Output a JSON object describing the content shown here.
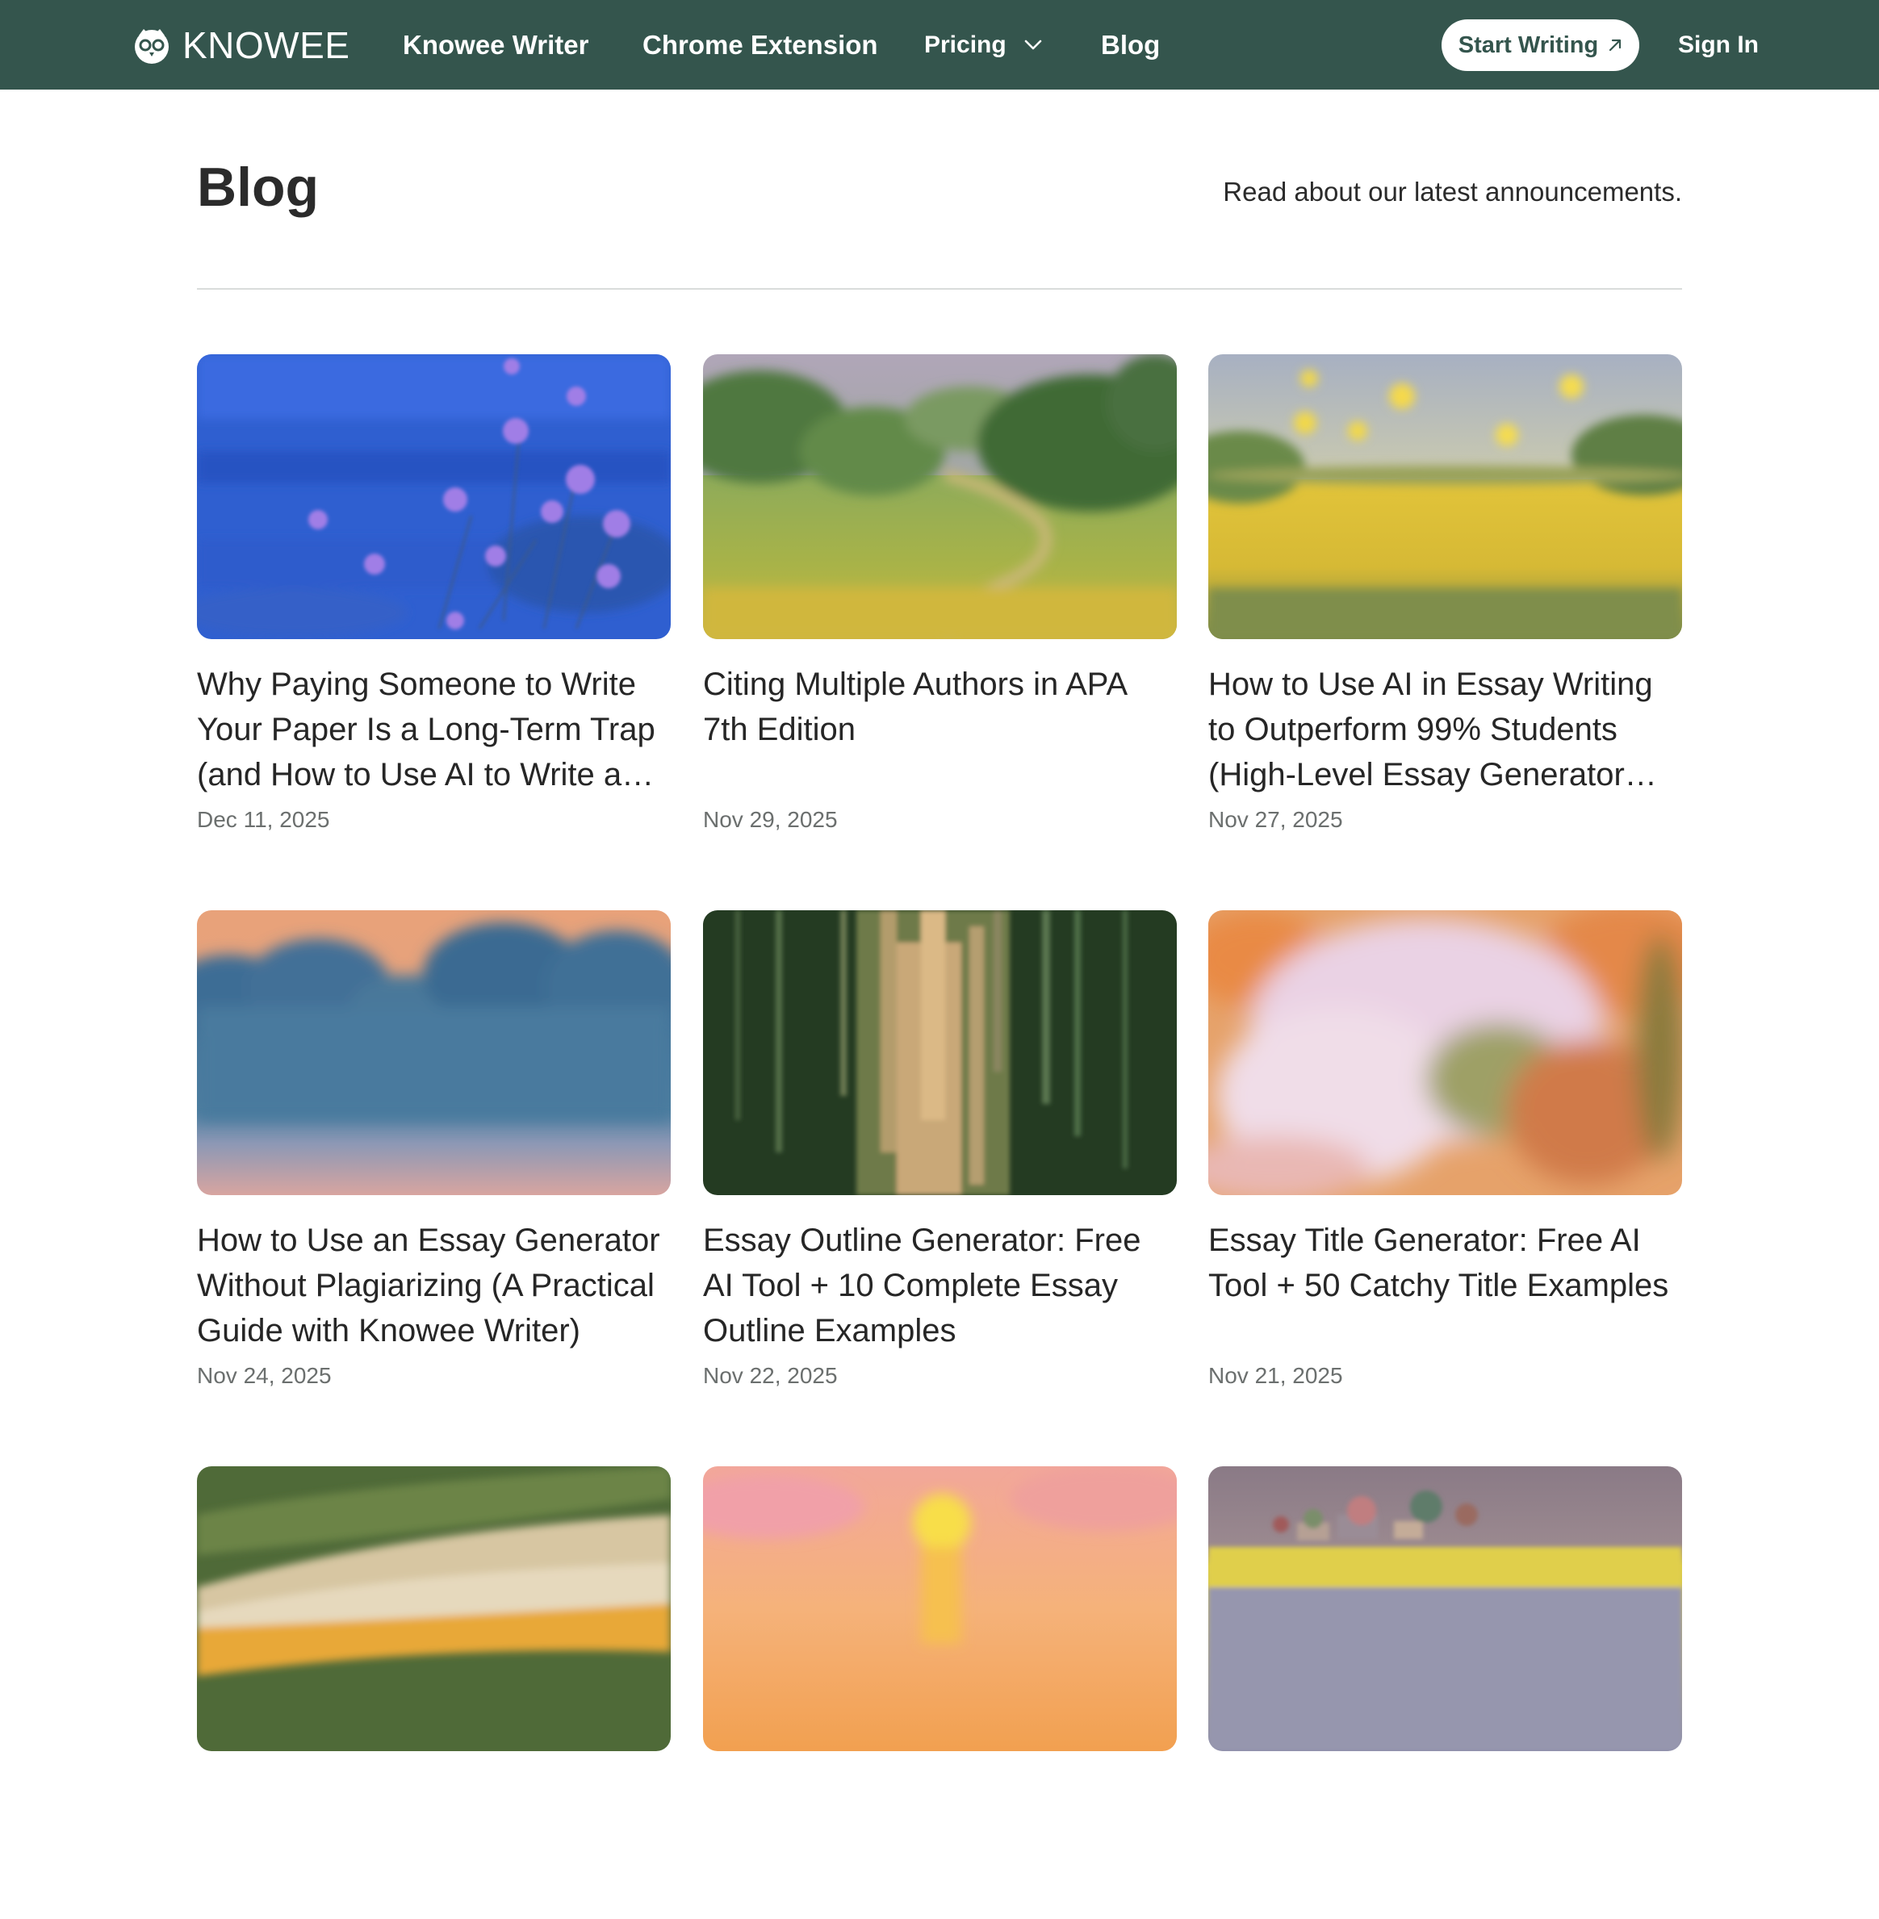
{
  "header": {
    "brand": "KNOWEE",
    "nav": [
      {
        "label": "Knowee Writer"
      },
      {
        "label": "Chrome Extension"
      },
      {
        "label": "Pricing"
      },
      {
        "label": "Blog"
      }
    ],
    "cta_label": "Start Writing",
    "signin_label": "Sign In",
    "colors": {
      "bar": "#34554d",
      "text": "#ffffff"
    },
    "icons": [
      "owl-logo-icon",
      "chevron-down-icon",
      "arrow-up-right-icon"
    ]
  },
  "page": {
    "title": "Blog",
    "subtitle": "Read about our latest announcements."
  },
  "posts": [
    {
      "title": "Why Paying Someone to Write Your Paper Is a Long-Term Trap (and How to Use AI to Write a…",
      "date": "Dec 11, 2025",
      "image": "blue-flowers-painting"
    },
    {
      "title": "Citing Multiple Authors in APA 7th Edition",
      "date": "Nov 29, 2025",
      "image": "green-meadow-path-painting"
    },
    {
      "title": "How to Use AI in Essay Writing to Outperform 99% Students (High-Level Essay Generator…",
      "date": "Nov 27, 2025",
      "image": "yellow-field-painting"
    },
    {
      "title": "How to Use an Essay Generator Without Plagiarizing (A Practical Guide with Knowee Writer)",
      "date": "Nov 24, 2025",
      "image": "blue-trees-sunset-painting"
    },
    {
      "title": "Essay Outline Generator: Free AI Tool + 10 Complete Essay Outline Examples",
      "date": "Nov 22, 2025",
      "image": "green-vertical-strokes-painting"
    },
    {
      "title": "Essay Title Generator: Free AI Tool + 50 Catchy Title Examples",
      "date": "Nov 21, 2025",
      "image": "pink-orange-flower-blur"
    },
    {
      "title": "",
      "date": "",
      "image": "green-leaves-abstract"
    },
    {
      "title": "",
      "date": "",
      "image": "orange-sunset-painting"
    },
    {
      "title": "",
      "date": "",
      "image": "village-field-painting"
    }
  ]
}
